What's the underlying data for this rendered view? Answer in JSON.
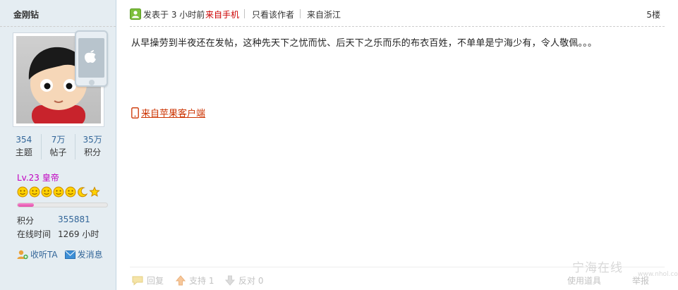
{
  "user": {
    "name": "金刚钻",
    "stats": [
      {
        "value": "354",
        "label": "主题"
      },
      {
        "value": "7万",
        "label": "帖子"
      },
      {
        "value": "35万",
        "label": "积分"
      }
    ],
    "level": "Lv.23 皇帝",
    "level_progress": 0.18,
    "score_label": "积分",
    "score_value": "355881",
    "online_label": "在线时间",
    "online_value": "1269 小时",
    "follow_label": "收听TA",
    "message_label": "发消息"
  },
  "post": {
    "posted_label": "发表于 3 小时前",
    "mobile_label": "来自手机",
    "author_only_label": "只看该作者",
    "location_label": "来自浙江",
    "floor_label": "5楼",
    "content": "从早操劳到半夜还在发帖，这种先天下之忧而忧、后天下之乐而乐的布衣百姓，不单单是宁海少有，令人敬佩。。。",
    "client_label": "来自苹果客户端",
    "footer": {
      "reply_label": "回复",
      "support_label": "支持 1",
      "oppose_label": "反对 0",
      "tools_label": "使用道具",
      "report_label": "举报"
    },
    "watermark": "宁海在线",
    "watermark_sub": "www.nhol.com"
  },
  "colors": {
    "sidebar_bg": "#e5edf2",
    "link_blue": "#336699",
    "mobile_red": "#cc0000",
    "client_link": "#cc3300",
    "level_purple": "#c000c0"
  }
}
